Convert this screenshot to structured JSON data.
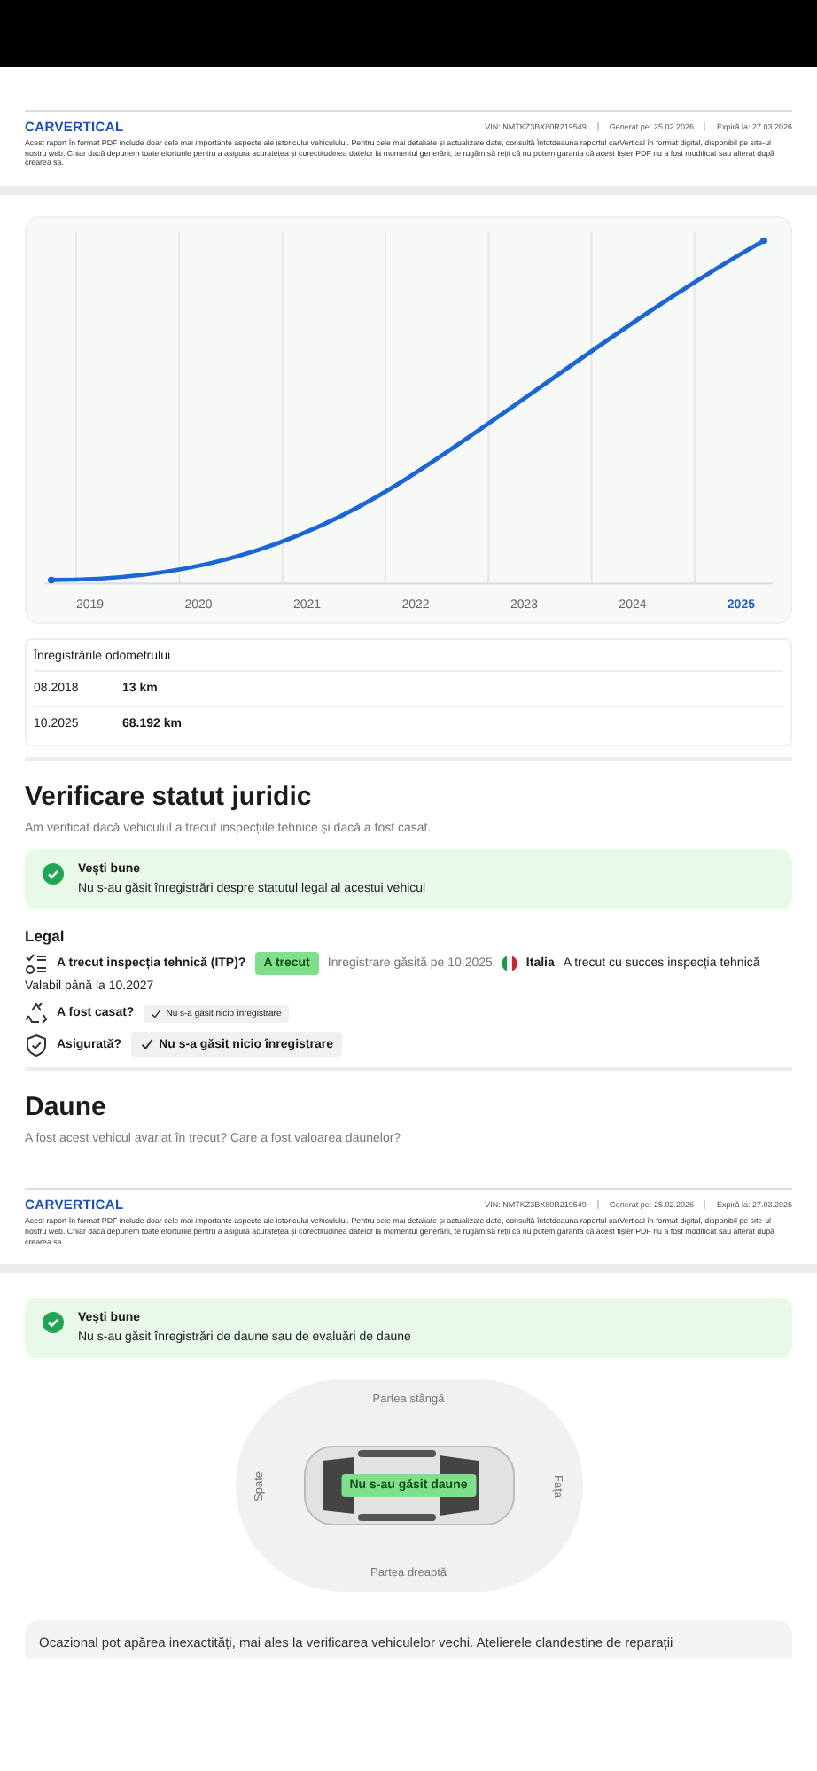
{
  "report_headers": [
    {
      "logo": "CARVERTICAL",
      "vin": "VIN: NMTKZ3BX80R219549",
      "generated": "Generat pe: 25.02.2026",
      "expires": "Expiră la: 27.03.2026",
      "disclaimer": "Acest raport în format PDF include doar cele mai importante aspecte ale istoricului vehiculului. Pentru cele mai detaliate și actualizate date, consultă întotdeauna raportul carVertical în format digital, disponibil pe site-ul nostru web. Chiar dacă depunem toate eforturile pentru a asigura acuratețea și corectitudinea datelor la momentul generării, te rugăm să reții că nu putem garanta că acest fișier PDF nu a fost modificat sau alterat după crearea sa."
    },
    {
      "logo": "CARVERTICAL",
      "vin": "VIN: NMTKZ3BX80R219549",
      "generated": "Generat pe: 25.02.2026",
      "expires": "Expiră la: 27.03.2026",
      "disclaimer": "Acest raport în format PDF include doar cele mai importante aspecte ale istoricului vehiculului. Pentru cele mai detaliate și actualizate date, consultă întotdeauna raportul carVertical în format digital, disponibil pe site-ul nostru web. Chiar dacă depunem toate eforturile pentru a asigura acuratețea și corectitudinea datelor la momentul generării, te rugăm să reții că nu putem garanta că acest fișier PDF nu a fost modificat sau alterat după crearea sa."
    }
  ],
  "odometer_chart": {
    "years": [
      {
        "label": "2019",
        "selected": false
      },
      {
        "label": "2020",
        "selected": false
      },
      {
        "label": "2021",
        "selected": false
      },
      {
        "label": "2022",
        "selected": false
      },
      {
        "label": "2023",
        "selected": false
      },
      {
        "label": "2024",
        "selected": false
      },
      {
        "label": "2025",
        "selected": true
      }
    ]
  },
  "odometer_table": {
    "title": "Înregistrările odometrului",
    "rows": [
      {
        "date": "08.2018",
        "value": "13 km"
      },
      {
        "date": "10.2025",
        "value": "68.192 km"
      }
    ]
  },
  "legal_section": {
    "title": "Verificare statut juridic",
    "subtitle": "Am verificat dacă vehiculul a trecut inspecțiile tehnice și dacă a fost casat.",
    "notice": {
      "title": "Vești bune",
      "text": "Nu s-au găsit înregistrări despre statutul legal al acestui vehicul"
    },
    "group_title": "Legal",
    "rows": [
      {
        "kind": "inspection",
        "question": "A trecut inspecția tehnică (ITP)?",
        "badge": "A trecut",
        "found": "Înregistrare găsită pe 10.2025",
        "country": "Italia",
        "detail": "A trecut cu succes inspecția tehnică",
        "valid": "Valabil până la 10.2027"
      },
      {
        "kind": "scrapped",
        "question": "A fost casat?",
        "chip": "Nu s-a găsit nicio înregistrare"
      },
      {
        "kind": "insured",
        "question": "Asigurată?",
        "chip": "Nu s-a găsit nicio înregistrare"
      }
    ]
  },
  "damage_section": {
    "title": "Daune",
    "subtitle": "A fost acest vehicul avariat în trecut? Care a fost valoarea daunelor?",
    "notice": {
      "title": "Vești bune",
      "text": "Nu s-au găsit înregistrări de daune sau de evaluări de daune"
    },
    "diagram": {
      "top": "Partea stângă",
      "left": "Spate",
      "right": "Fața",
      "bottom": "Partea dreaptă",
      "badge": "Nu s-au găsit daune"
    },
    "note": "Ocazional pot apărea inexactități, mai ales la verificarea vehiculelor vechi. Atelierele clandestine de reparații"
  }
}
